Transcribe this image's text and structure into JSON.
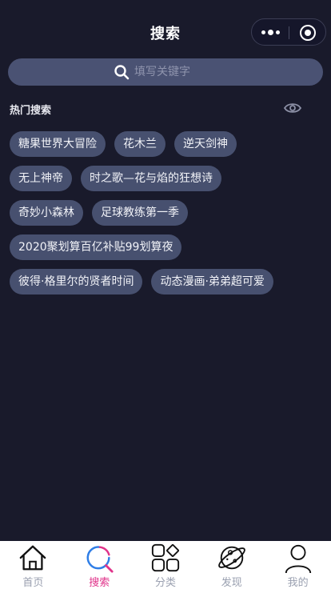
{
  "header": {
    "title": "搜索"
  },
  "search": {
    "placeholder": "填写关键字",
    "value": ""
  },
  "hot": {
    "title": "热门搜索",
    "rows": [
      [
        "糖果世界大冒险",
        "花木兰",
        "逆天剑神"
      ],
      [
        "无上神帝",
        "时之歌—花与焰的狂想诗"
      ],
      [
        "奇妙小森林",
        "足球教练第一季"
      ],
      [
        "2020聚划算百亿补贴99划算夜"
      ],
      [
        "彼得·格里尔的贤者时间",
        "动态漫画·弟弟超可爱"
      ]
    ]
  },
  "tabbar": {
    "home": "首页",
    "search": "搜索",
    "category": "分类",
    "discover": "发现",
    "mine": "我的",
    "active": "search",
    "accent": "#e0338a"
  },
  "colors": {
    "background": "#191a2b",
    "search_bar": "#4a5273",
    "tag": "#47506f"
  }
}
